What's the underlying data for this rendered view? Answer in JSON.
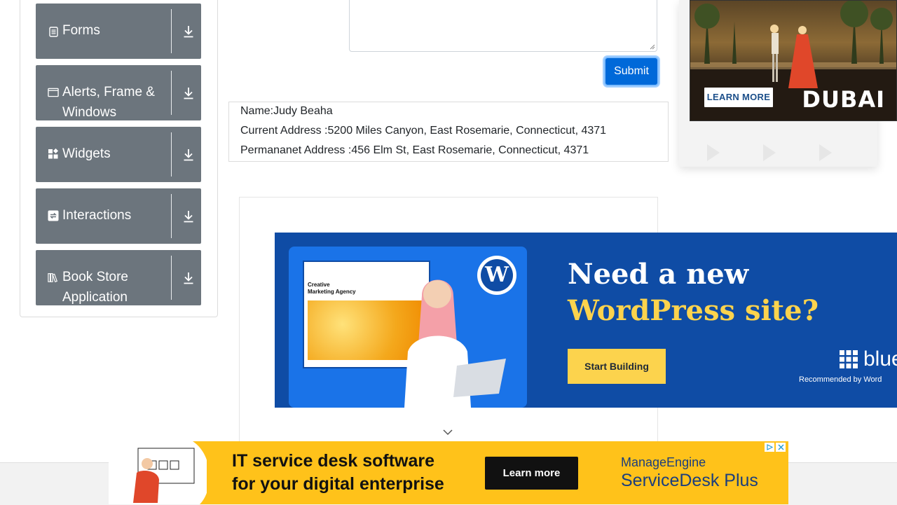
{
  "sidebar": {
    "groups": [
      {
        "label": "Forms",
        "icon": "form-icon",
        "download_icon": "download-icon"
      },
      {
        "label": "Alerts, Frame & Windows",
        "icon": "window-icon",
        "download_icon": "download-icon"
      },
      {
        "label": "Widgets",
        "icon": "widgets-icon",
        "download_icon": "download-icon"
      },
      {
        "label": "Interactions",
        "icon": "interactions-icon",
        "download_icon": "download-icon"
      },
      {
        "label": "Book Store Application",
        "icon": "books-icon",
        "download_icon": "download-icon"
      }
    ]
  },
  "form": {
    "submit_label": "Submit",
    "output": {
      "name": "Name:Judy Beaha",
      "current_address": "Current Address :5200 Miles Canyon, East Rosemarie, Connecticut, 4371",
      "permanent_address": "Permananet Address :456 Elm St, East Rosemarie, Connecticut, 4371"
    }
  },
  "ads": {
    "dubai": {
      "cta": "LEARN MORE",
      "logo": "DUBAI"
    },
    "wordpress": {
      "line1": "Need a new",
      "line2": "WordPress site?",
      "cta": "Start Building",
      "brand": "blue",
      "recommended": "Recommended by Word",
      "mock_heading": "Creative Marketing Agency"
    },
    "servicedesk": {
      "line1": "IT service desk software",
      "line2": "for your digital enterprise",
      "cta": "Learn more",
      "brand1": "ManageEngine",
      "brand2": "ServiceDesk Plus"
    }
  },
  "colors": {
    "sidebar_group": "#6c757d",
    "submit": "#0069d9",
    "wp_blue": "#0f4ca5",
    "wp_yellow": "#fcd34d",
    "bottom_ad": "#ffc21a"
  }
}
